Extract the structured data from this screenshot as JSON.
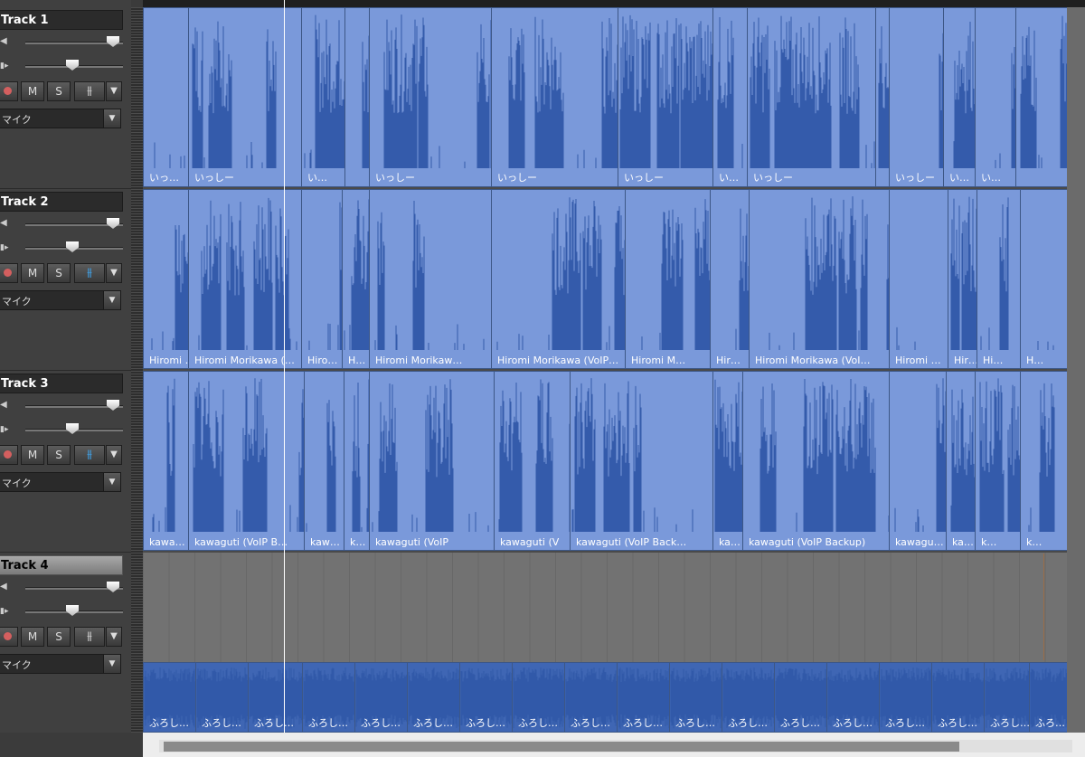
{
  "tracks": [
    {
      "name": "Track 1",
      "input": "マイク",
      "selected": false,
      "fx_active": false,
      "clip_style": "light",
      "clips": [
        {
          "s": 0,
          "e": 50,
          "label": "いっ…"
        },
        {
          "s": 50,
          "e": 175,
          "label": "いっしー"
        },
        {
          "s": 175,
          "e": 223,
          "label": "い…"
        },
        {
          "s": 223,
          "e": 250,
          "label": ""
        },
        {
          "s": 250,
          "e": 385,
          "label": "いっしー"
        },
        {
          "s": 385,
          "e": 525,
          "label": "いっしー"
        },
        {
          "s": 525,
          "e": 630,
          "label": "いっしー"
        },
        {
          "s": 630,
          "e": 668,
          "label": "い…"
        },
        {
          "s": 668,
          "e": 810,
          "label": "いっしー"
        },
        {
          "s": 810,
          "e": 825,
          "label": ""
        },
        {
          "s": 825,
          "e": 885,
          "label": "いっしー"
        },
        {
          "s": 885,
          "e": 920,
          "label": "い…"
        },
        {
          "s": 920,
          "e": 965,
          "label": "い…"
        },
        {
          "s": 965,
          "e": 1022,
          "label": ""
        }
      ]
    },
    {
      "name": "Track 2",
      "input": "マイク",
      "selected": false,
      "fx_active": true,
      "clip_style": "light",
      "clips": [
        {
          "s": 0,
          "e": 50,
          "label": "Hiromi …"
        },
        {
          "s": 50,
          "e": 175,
          "label": "Hiromi Morikawa (…"
        },
        {
          "s": 175,
          "e": 220,
          "label": "Hiro…"
        },
        {
          "s": 220,
          "e": 250,
          "label": "H…"
        },
        {
          "s": 250,
          "e": 385,
          "label": "Hiromi Morikaw…"
        },
        {
          "s": 385,
          "e": 533,
          "label": "Hiromi Morikawa (VoIP…"
        },
        {
          "s": 533,
          "e": 627,
          "label": "Hiromi M…"
        },
        {
          "s": 627,
          "e": 670,
          "label": "Hir…"
        },
        {
          "s": 670,
          "e": 825,
          "label": "Hiromi Morikawa (VoI…"
        },
        {
          "s": 825,
          "e": 890,
          "label": "Hiromi …"
        },
        {
          "s": 890,
          "e": 922,
          "label": "Hir…"
        },
        {
          "s": 922,
          "e": 970,
          "label": "Hi…"
        },
        {
          "s": 970,
          "e": 1022,
          "label": "H…"
        }
      ]
    },
    {
      "name": "Track 3",
      "input": "マイク",
      "selected": false,
      "fx_active": true,
      "clip_style": "light",
      "clips": [
        {
          "s": 0,
          "e": 50,
          "label": "kawa…"
        },
        {
          "s": 50,
          "e": 178,
          "label": "kawaguti (VoIP B…"
        },
        {
          "s": 178,
          "e": 222,
          "label": "kaw…"
        },
        {
          "s": 222,
          "e": 250,
          "label": "k…"
        },
        {
          "s": 250,
          "e": 388,
          "label": "kawaguti (VoIP"
        },
        {
          "s": 388,
          "e": 472,
          "label": "kawaguti (V"
        },
        {
          "s": 472,
          "e": 630,
          "label": "kawaguti (VoIP Back…"
        },
        {
          "s": 630,
          "e": 663,
          "label": "ka…"
        },
        {
          "s": 663,
          "e": 825,
          "label": "kawaguti (VoIP Backup)"
        },
        {
          "s": 825,
          "e": 888,
          "label": "kawagu…"
        },
        {
          "s": 888,
          "e": 920,
          "label": "ka…"
        },
        {
          "s": 920,
          "e": 970,
          "label": "k…"
        },
        {
          "s": 970,
          "e": 1022,
          "label": "k…"
        }
      ]
    },
    {
      "name": "Track 4",
      "input": "マイク",
      "selected": true,
      "fx_active": false,
      "clip_style": "dark",
      "clips": [
        {
          "s": 0,
          "e": 58,
          "label": "ふろし…"
        },
        {
          "s": 58,
          "e": 116,
          "label": "ふろし…"
        },
        {
          "s": 116,
          "e": 176,
          "label": "ふろし…"
        },
        {
          "s": 176,
          "e": 234,
          "label": "ふろし…"
        },
        {
          "s": 234,
          "e": 292,
          "label": "ふろし…"
        },
        {
          "s": 292,
          "e": 350,
          "label": "ふろし…"
        },
        {
          "s": 350,
          "e": 408,
          "label": "ふろし…"
        },
        {
          "s": 408,
          "e": 466,
          "label": "ふろし…"
        },
        {
          "s": 466,
          "e": 524,
          "label": "ふろし…"
        },
        {
          "s": 524,
          "e": 582,
          "label": "ふろし…"
        },
        {
          "s": 582,
          "e": 640,
          "label": "ふろし…"
        },
        {
          "s": 640,
          "e": 698,
          "label": "ふろし…"
        },
        {
          "s": 698,
          "e": 756,
          "label": "ふろし…"
        },
        {
          "s": 756,
          "e": 814,
          "label": "ふろし…"
        },
        {
          "s": 814,
          "e": 872,
          "label": "ふろし…"
        },
        {
          "s": 872,
          "e": 930,
          "label": "ふろし…"
        },
        {
          "s": 930,
          "e": 980,
          "label": "ふろし…"
        },
        {
          "s": 980,
          "e": 1022,
          "label": "ふろ…"
        }
      ]
    }
  ],
  "buttons": {
    "mute": "M",
    "solo": "S",
    "fx": "⫵",
    "dropdown": "▼"
  },
  "icons": {
    "speaker": "◀",
    "pan": "▮▸",
    "record": "record-dot"
  },
  "colors": {
    "clip_light": "#7a99da",
    "clip_dark": "#3f66b4",
    "waveform": "#2d55a6",
    "fx_active": "#3fa9f5",
    "record": "#d45f5f"
  }
}
